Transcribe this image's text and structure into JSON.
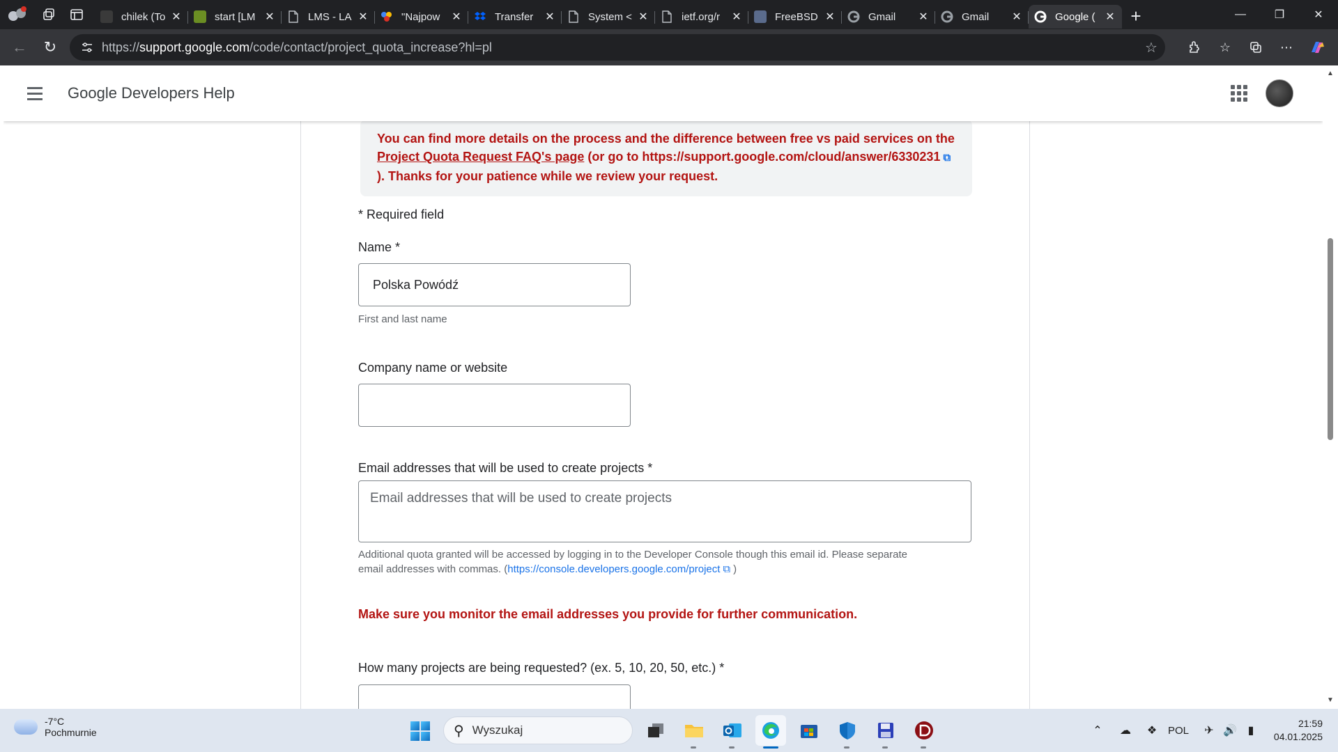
{
  "browser": {
    "tabs": [
      {
        "title": "chilek (To",
        "icon": "github-icon",
        "color": "#3a3a3a"
      },
      {
        "title": "start [LM",
        "icon": "wiki-icon",
        "color": "#6b8e23"
      },
      {
        "title": "LMS - LA",
        "icon": "document-icon",
        "color": "#bdc1c6"
      },
      {
        "title": "\"Najpow",
        "icon": "brand-icon",
        "color": "#d93025"
      },
      {
        "title": "Transfer",
        "icon": "dropbox-icon",
        "color": "#0061fe"
      },
      {
        "title": "System <",
        "icon": "document-icon",
        "color": "#bdc1c6"
      },
      {
        "title": "ietf.org/r",
        "icon": "document-icon",
        "color": "#bdc1c6"
      },
      {
        "title": "FreeBSD",
        "icon": "freebsd-icon",
        "color": "#5a6b8c"
      },
      {
        "title": "Gmail",
        "icon": "google-icon",
        "color": "#9aa0a6"
      },
      {
        "title": "Gmail",
        "icon": "google-icon",
        "color": "#9aa0a6"
      },
      {
        "title": "Google (",
        "icon": "google-icon",
        "color": "#ffffff",
        "active": true
      }
    ],
    "url_prefix": "https://",
    "url_host": "support.google.com",
    "url_path": "/code/contact/project_quota_increase?hl=pl"
  },
  "page": {
    "app_title": "Google Developers Help",
    "notice": {
      "line1": "You can find more details on the process and the difference between free vs paid services on the",
      "link_text": "Project Quota Request FAQ's page",
      "line2_middle": "(or go to https://support.google.com/cloud/answer/6330231",
      "line3": "). Thanks for your patience while we review your request."
    },
    "required_note": "* Required field",
    "name_label": "Name *",
    "name_value": "Polska Powódź",
    "name_hint": "First and last name",
    "company_label": "Company name or website",
    "company_value": "",
    "email_label": "Email addresses that will be used to create projects *",
    "email_placeholder": "Email addresses that will be used to create projects",
    "email_help_1": "Additional quota granted will be accessed by logging in to the Developer Console though this email id. Please separate",
    "email_help_2": "email addresses with commas. (",
    "email_help_link": "https://console.developers.google.com/project",
    "email_help_end": ")",
    "warning": "Make sure you monitor the email addresses you provide for further communication.",
    "projects_label": "How many projects are being requested? (ex. 5, 10, 20, 50, etc.) *"
  },
  "taskbar": {
    "weather_temp": "-7°C",
    "weather_desc": "Pochmurnie",
    "search_placeholder": "Wyszukaj",
    "language": "POL",
    "time": "21:59",
    "date": "04.01.2025"
  }
}
